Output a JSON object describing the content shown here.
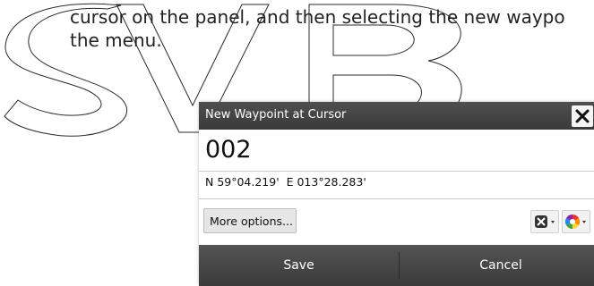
{
  "document": {
    "line1": "cursor on the panel, and then selecting the new waypo",
    "line2": "the menu."
  },
  "dialog": {
    "title": "New Waypoint at Cursor",
    "name_value": "002",
    "position": "N 59°04.219'  E 013°28.283'",
    "more_options_label": "More options...",
    "save_label": "Save",
    "cancel_label": "Cancel"
  },
  "icons": {
    "close": "close-icon",
    "symbol": "waypoint-symbol-icon",
    "color": "color-wheel-icon"
  },
  "colors": {
    "titlebar": "#444444",
    "footer": "#474747",
    "watermark": "#333333"
  }
}
